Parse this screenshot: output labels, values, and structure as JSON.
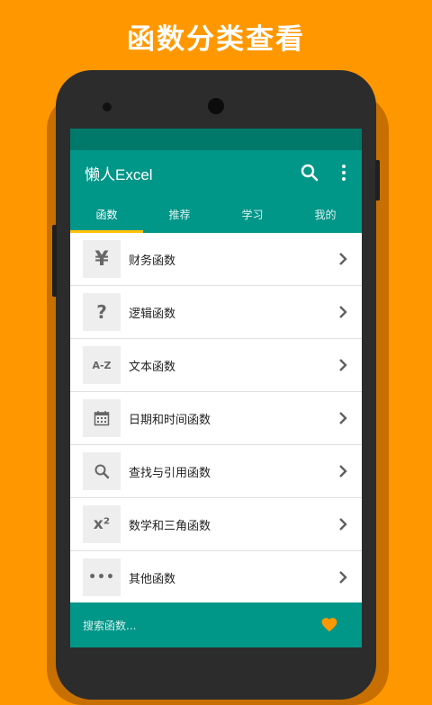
{
  "headline": "函数分类查看",
  "app": {
    "title": "懒人Excel",
    "search_icon": "search-icon",
    "more_icon": "more-vert-icon"
  },
  "tabs": [
    {
      "label": "函数",
      "active": true
    },
    {
      "label": "推荐",
      "active": false
    },
    {
      "label": "学习",
      "active": false
    },
    {
      "label": "我的",
      "active": false
    }
  ],
  "categories": [
    {
      "label": "财务函数",
      "icon_text": "¥",
      "icon": "yen-icon"
    },
    {
      "label": "逻辑函数",
      "icon_text": "?",
      "icon": "question-icon"
    },
    {
      "label": "文本函数",
      "icon_text": "A-Z",
      "icon": "text-az-icon"
    },
    {
      "label": "日期和时间函数",
      "icon_text": "",
      "icon": "calendar-icon"
    },
    {
      "label": "查找与引用函数",
      "icon_text": "",
      "icon": "search-icon"
    },
    {
      "label": "数学和三角函数",
      "icon_text": "x²",
      "icon": "math-icon"
    },
    {
      "label": "其他函数",
      "icon_text": "•••",
      "icon": "more-horiz-icon"
    }
  ],
  "bottom_bar": {
    "placeholder": "搜索函数...",
    "heart_icon": "heart-icon"
  },
  "colors": {
    "background": "#ff9800",
    "primary": "#009688",
    "primary_dark": "#00796b",
    "accent": "#ffc107",
    "heart": "#ff9800"
  }
}
